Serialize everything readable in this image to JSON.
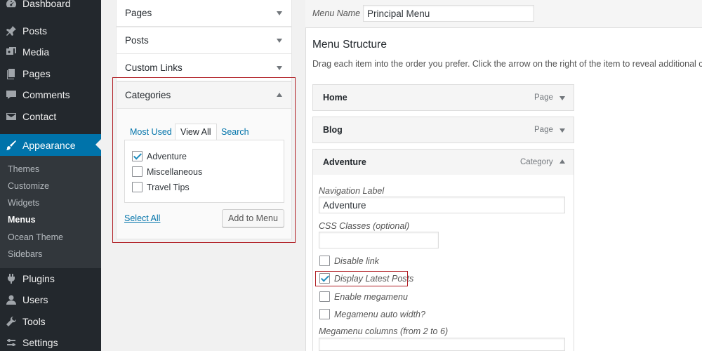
{
  "sidebar": {
    "top": [
      {
        "key": "dashboard",
        "label": "Dashboard",
        "icon": "dashboard-icon"
      },
      {
        "key": "posts",
        "label": "Posts",
        "icon": "pin-icon"
      },
      {
        "key": "media",
        "label": "Media",
        "icon": "media-icon"
      },
      {
        "key": "pages",
        "label": "Pages",
        "icon": "page-icon"
      },
      {
        "key": "comments",
        "label": "Comments",
        "icon": "comment-icon"
      },
      {
        "key": "contact",
        "label": "Contact",
        "icon": "mail-icon"
      },
      {
        "key": "appearance",
        "label": "Appearance",
        "icon": "brush-icon"
      }
    ],
    "submenu": [
      "Themes",
      "Customize",
      "Widgets",
      "Menus",
      "Ocean Theme",
      "Sidebars"
    ],
    "bottom": [
      {
        "key": "plugins",
        "label": "Plugins",
        "icon": "plugin-icon"
      },
      {
        "key": "users",
        "label": "Users",
        "icon": "user-icon"
      },
      {
        "key": "tools",
        "label": "Tools",
        "icon": "wrench-icon"
      },
      {
        "key": "settings",
        "label": "Settings",
        "icon": "settings-icon"
      }
    ],
    "active_color": "#0073aa"
  },
  "accordion": {
    "pages": "Pages",
    "posts": "Posts",
    "custom_links": "Custom Links",
    "categories": {
      "title": "Categories",
      "tabs": [
        "Most Used",
        "View All",
        "Search"
      ],
      "selected_tab": "View All",
      "items": [
        {
          "label": "Adventure",
          "checked": true
        },
        {
          "label": "Miscellaneous",
          "checked": false
        },
        {
          "label": "Travel Tips",
          "checked": false
        }
      ],
      "select_all": "Select All",
      "add_button": "Add to Menu"
    }
  },
  "editor": {
    "menu_name_label": "Menu Name",
    "menu_name_value": "Principal Menu",
    "structure_title": "Menu Structure",
    "structure_help": "Drag each item into the order you prefer. Click the arrow on the right of the item to reveal additional config",
    "items": [
      {
        "title": "Home",
        "type": "Page"
      },
      {
        "title": "Blog",
        "type": "Page"
      },
      {
        "title": "Adventure",
        "type": "Category"
      }
    ],
    "settings": {
      "nav_label_title": "Navigation Label",
      "nav_label_value": "Adventure",
      "css_classes_title": "CSS Classes (optional)",
      "disable_link": "Disable link",
      "display_latest_posts": "Display Latest Posts",
      "enable_megamenu": "Enable megamenu",
      "megamenu_auto_width": "Megamenu auto width?",
      "megamenu_columns": "Megamenu columns (from 2 to 6)"
    }
  },
  "highlight_color": "#b01e24"
}
